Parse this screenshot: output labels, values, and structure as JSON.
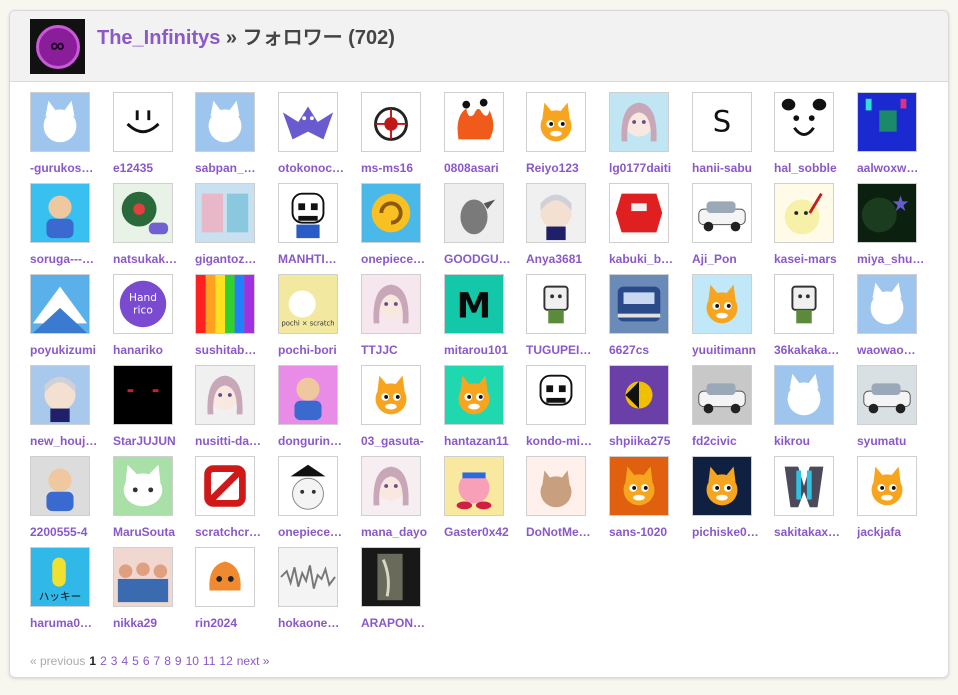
{
  "header": {
    "owner_name": "The_Infinitys",
    "separator": "»",
    "section_title": "フォロワー",
    "count": "(702)",
    "avatar_icon": "infinity-logo-icon"
  },
  "followers": [
    {
      "name": "-gurukos…",
      "icon": "default-cat-avatar",
      "bg": "#9ec5ee"
    },
    {
      "name": "e12435",
      "icon": "smiley-face-avatar",
      "bg": "#ffffff"
    },
    {
      "name": "sabpan_…",
      "icon": "default-cat-avatar",
      "bg": "#9ec5ee"
    },
    {
      "name": "otokonoc…",
      "icon": "bat-creature-avatar",
      "bg": "#ffffff"
    },
    {
      "name": "ms-ms16",
      "icon": "emblem-avatar",
      "bg": "#ffffff"
    },
    {
      "name": "0808asari",
      "icon": "flame-creature-avatar",
      "bg": "#ffffff"
    },
    {
      "name": "Reiyo123",
      "icon": "scratch-cat-avatar",
      "bg": "#ffffff"
    },
    {
      "name": "lg0177daiti",
      "icon": "anime-girl-avatar",
      "bg": "#bfe6f2"
    },
    {
      "name": "hanii-sabu",
      "icon": "letter-s-avatar",
      "bg": "#ffffff"
    },
    {
      "name": "hal_sobble",
      "icon": "face-doodle-avatar",
      "bg": "#ffffff"
    },
    {
      "name": "aalwoxw…",
      "icon": "pixel-art-avatar",
      "bg": "#1a2ad0"
    },
    {
      "name": "soruga---…",
      "icon": "character-avatar",
      "bg": "#38c0f0"
    },
    {
      "name": "natsukak…",
      "icon": "controller-avatar",
      "bg": "#e8f2e6"
    },
    {
      "name": "gigantoz…",
      "icon": "anime-duo-avatar",
      "bg": "#c8e0f0"
    },
    {
      "name": "MANHTI…",
      "icon": "skeleton-avatar",
      "bg": "#ffffff"
    },
    {
      "name": "onepiece…",
      "icon": "snail-avatar",
      "bg": "#4ab8e8"
    },
    {
      "name": "GOODGU…",
      "icon": "bird-avatar",
      "bg": "#eeeeee"
    },
    {
      "name": "Anya3681",
      "icon": "anime-boy-avatar",
      "bg": "#f0f0f0"
    },
    {
      "name": "kabuki_b…",
      "icon": "red-mask-avatar",
      "bg": "#ffffff"
    },
    {
      "name": "Aji_Pon",
      "icon": "car-avatar",
      "bg": "#ffffff"
    },
    {
      "name": "kasei-mars",
      "icon": "moon-face-avatar",
      "bg": "#fffbe8"
    },
    {
      "name": "miya_shu…",
      "icon": "star-night-avatar",
      "bg": "#0c2010"
    },
    {
      "name": "poyukizumi",
      "icon": "mount-fuji-avatar",
      "bg": "#5ab0e8"
    },
    {
      "name": "hanariko",
      "icon": "hand-rico-avatar",
      "bg": "#ffffff"
    },
    {
      "name": "sushitab…",
      "icon": "rainbow-avatar",
      "bg": "#ff7a00"
    },
    {
      "name": "pochi-bori",
      "icon": "pochi-scratch-avatar",
      "bg": "#f3e8a0"
    },
    {
      "name": "TTJJC",
      "icon": "anime-girl-avatar",
      "bg": "#f6e6ee"
    },
    {
      "name": "mitarou101",
      "icon": "letter-m-avatar",
      "bg": "#12c8a8"
    },
    {
      "name": "TUGUPEI…",
      "icon": "robot-avatar",
      "bg": "#ffffff"
    },
    {
      "name": "6627cs",
      "icon": "train-avatar",
      "bg": "#6a8ab8"
    },
    {
      "name": "yuuitimann",
      "icon": "scratch-cat-avatar",
      "bg": "#c0e8f8"
    },
    {
      "name": "36kakaka…",
      "icon": "robot-avatar",
      "bg": "#ffffff"
    },
    {
      "name": "waowao…",
      "icon": "default-cat-avatar",
      "bg": "#9ec5ee"
    },
    {
      "name": "new_houj…",
      "icon": "anime-boy-avatar",
      "bg": "#a8c8ec"
    },
    {
      "name": "StarJUJUN",
      "icon": "dark-eyes-avatar",
      "bg": "#000000"
    },
    {
      "name": "nusitti-da…",
      "icon": "anime-girl-avatar",
      "bg": "#f0f0f0"
    },
    {
      "name": "dongurin…",
      "icon": "character-avatar",
      "bg": "#e88ce8"
    },
    {
      "name": "03_gasuta-",
      "icon": "scratch-cat-avatar",
      "bg": "#ffffff"
    },
    {
      "name": "hantazan11",
      "icon": "scratch-cat-avatar",
      "bg": "#20d8b0"
    },
    {
      "name": "kondo-mi…",
      "icon": "skull-avatar",
      "bg": "#ffffff"
    },
    {
      "name": "shpiika275",
      "icon": "geometric-logo-avatar",
      "bg": "#6a3fa8"
    },
    {
      "name": "fd2civic",
      "icon": "car-avatar",
      "bg": "#c8c8c8"
    },
    {
      "name": "kikrou",
      "icon": "default-cat-avatar",
      "bg": "#9ec5ee"
    },
    {
      "name": "syumatu",
      "icon": "car-avatar",
      "bg": "#d8e0e4"
    },
    {
      "name": "2200555-4",
      "icon": "character-avatar",
      "bg": "#dcdcdc"
    },
    {
      "name": "MaruSouta",
      "icon": "cute-cat-avatar",
      "bg": "#a8e0a8"
    },
    {
      "name": "scratchcr…",
      "icon": "no-sign-avatar",
      "bg": "#ffffff"
    },
    {
      "name": "onepiece…",
      "icon": "pirate-avatar",
      "bg": "#ffffff"
    },
    {
      "name": "mana_dayo",
      "icon": "anime-girl-avatar",
      "bg": "#f6eef0"
    },
    {
      "name": "Gaster0x42",
      "icon": "kirby-avatar",
      "bg": "#f8e8a0"
    },
    {
      "name": "DoNotMe…",
      "icon": "cat-avatar",
      "bg": "#fff0ec"
    },
    {
      "name": "sans-1020",
      "icon": "scratch-cat-avatar",
      "bg": "#e06010"
    },
    {
      "name": "pichiske0…",
      "icon": "scratch-cat-avatar",
      "bg": "#102040"
    },
    {
      "name": "sakitakax…",
      "icon": "metal-logo-avatar",
      "bg": "#ffffff"
    },
    {
      "name": "jackjafa",
      "icon": "scratch-cat-avatar",
      "bg": "#ffffff"
    },
    {
      "name": "haruma0…",
      "icon": "hakkii-avatar",
      "bg": "#30b8e8"
    },
    {
      "name": "nikka29",
      "icon": "group-avatar",
      "bg": "#f0d8d0"
    },
    {
      "name": "rin2024",
      "icon": "squid-avatar",
      "bg": "#ffffff"
    },
    {
      "name": "hokaone…",
      "icon": "waveform-avatar",
      "bg": "#f4f4f4"
    },
    {
      "name": "ARAPON…",
      "icon": "dark-photo-avatar",
      "bg": "#181818"
    }
  ],
  "pagination": {
    "prev": "« previous",
    "current": "1",
    "pages": [
      "2",
      "3",
      "4",
      "5",
      "6",
      "7",
      "8",
      "9",
      "10",
      "11",
      "12"
    ],
    "next": "next »"
  },
  "colors": {
    "link": "#8a58c8",
    "header_bg": "#f2f2f2",
    "page_bg": "#f7f6ef"
  }
}
